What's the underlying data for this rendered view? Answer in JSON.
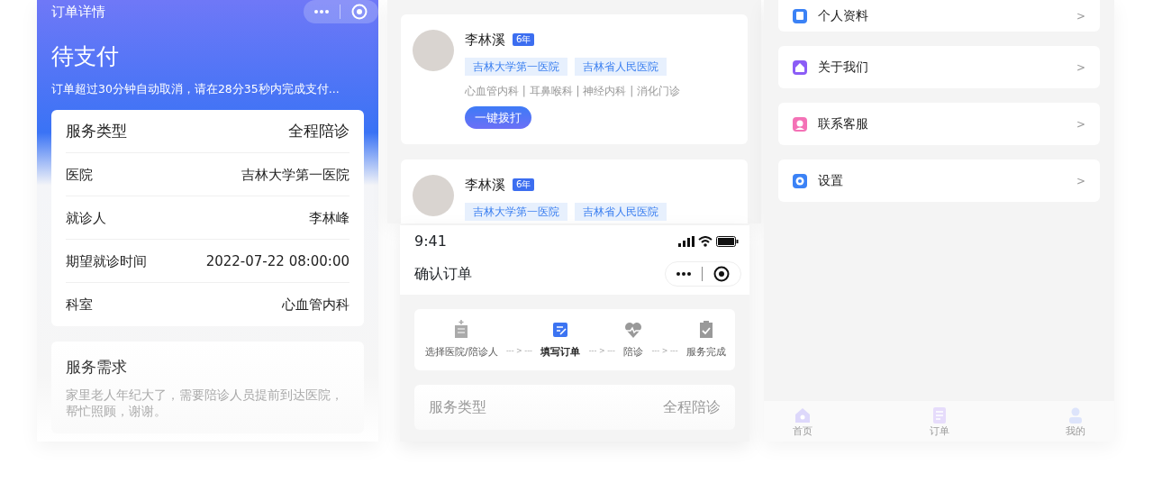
{
  "order_detail": {
    "title": "订单详情",
    "status": "待支付",
    "notice": "订单超过30分钟自动取消，请在28分35秒内完成支付...",
    "info_rows": [
      {
        "label": "服务类型",
        "value": "全程陪诊"
      },
      {
        "label": "医院",
        "value": "吉林大学第一医院"
      },
      {
        "label": "就诊人",
        "value": "李林峰"
      },
      {
        "label": "期望就诊时间",
        "value": "2022-07-22 08:00:00"
      },
      {
        "label": "科室",
        "value": "心血管内科"
      }
    ],
    "request": {
      "title": "服务需求",
      "text": "家里老人年纪大了，需要陪诊人员提前到达医院，帮忙照顾，谢谢。"
    }
  },
  "escort_list": {
    "cards": [
      {
        "name": "李林溪",
        "years": "6年",
        "hospitals": [
          "吉林大学第一医院",
          "吉林省人民医院"
        ],
        "departments": "心血管内科 | 耳鼻喉科 | 神经内科 | 消化门诊",
        "call_button": "一键拨打"
      },
      {
        "name": "李林溪",
        "years": "6年",
        "hospitals": [
          "吉林大学第一医院",
          "吉林省人民医院"
        ]
      }
    ]
  },
  "confirm_order": {
    "time": "9:41",
    "title": "确认订单",
    "steps": [
      {
        "label": "选择医院/陪诊人",
        "kind": "hospital",
        "selected": false
      },
      {
        "label": "填写订单",
        "kind": "form",
        "selected": true
      },
      {
        "label": "陪诊",
        "kind": "heart",
        "selected": false
      },
      {
        "label": "服务完成",
        "kind": "done",
        "selected": false
      }
    ],
    "connectors": [
      "--- > ---",
      "--- > ---",
      "--- > ---"
    ],
    "service_row": {
      "label": "服务类型",
      "value": "全程陪诊"
    }
  },
  "profile": {
    "menu": [
      {
        "label": "个人资料",
        "kind": "card",
        "color": "#3b82f6",
        "arrow": ">"
      },
      {
        "label": "关于我们",
        "kind": "home",
        "color": "#8b5cf6",
        "arrow": ">"
      },
      {
        "label": "联系客服",
        "kind": "support",
        "color": "#f472b6",
        "arrow": ">"
      },
      {
        "label": "设置",
        "kind": "gear",
        "color": "#3b82f6",
        "arrow": ">"
      }
    ],
    "tab_bar": [
      {
        "label": "首页",
        "kind": "home"
      },
      {
        "label": "订单",
        "kind": "list"
      },
      {
        "label": "我的",
        "kind": "user"
      }
    ]
  }
}
